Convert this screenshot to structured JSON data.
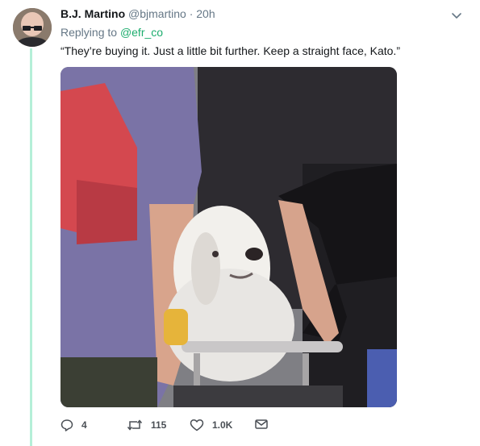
{
  "tweet": {
    "author_name": "B.J. Martino",
    "author_handle": "@bjmartino",
    "separator": "·",
    "time": "20h",
    "replying_prefix": "Replying to",
    "replying_to": "@efr_co",
    "text": "“They’re buying it. Just a little bit further. Keep a straight face, Kato.”",
    "media_icon": "photo-of-dog-in-cart",
    "accent_color": "#1dad6e",
    "thread_line_color": "#b5efd8"
  },
  "actions": {
    "reply_icon": "reply-icon",
    "reply_count": "4",
    "retweet_icon": "retweet-icon",
    "retweet_count": "115",
    "like_icon": "heart-icon",
    "like_count": "1.0K",
    "message_icon": "envelope-icon"
  }
}
